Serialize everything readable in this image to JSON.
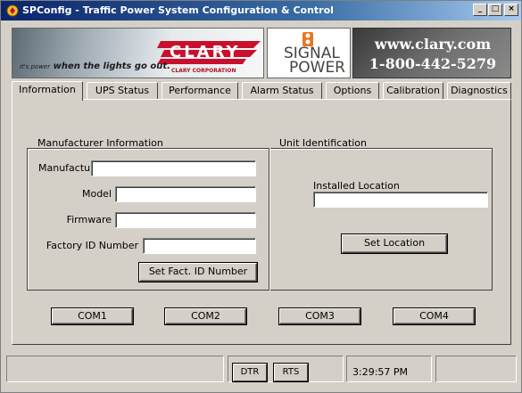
{
  "window": {
    "title": "SPConfig - Traffic Power System Configuration & Control",
    "controls": {
      "minimize": "_",
      "maximize": "□",
      "close": "×"
    }
  },
  "banner": {
    "tagline_prefix": "it's power",
    "tagline_main": "when the lights go out.",
    "brand": "CLARY",
    "brand_sub": "CLARY CORPORATION",
    "signal_line1": "SIGNAL",
    "signal_line2": "POWER",
    "website": "www.clary.com",
    "phone": "1-800-442-5279"
  },
  "tabs": [
    {
      "label": "Information",
      "active": true
    },
    {
      "label": "UPS Status",
      "active": false
    },
    {
      "label": "Performance",
      "active": false
    },
    {
      "label": "Alarm Status",
      "active": false
    },
    {
      "label": "Options",
      "active": false
    },
    {
      "label": "Calibration",
      "active": false
    },
    {
      "label": "Diagnostics",
      "active": false
    }
  ],
  "manufacturer_info": {
    "title": "Manufacturer Information",
    "manufacturer_label": "Manufacturer",
    "manufacturer_value": "",
    "model_label": "Model",
    "model_value": "",
    "firmware_label": "Firmware",
    "firmware_value": "",
    "factory_id_label": "Factory ID Number",
    "factory_id_value": "",
    "set_factory_id_button": "Set Fact. ID Number"
  },
  "unit_identification": {
    "title": "Unit Identification",
    "installed_location_label": "Installed Location",
    "installed_location_value": "",
    "set_location_button": "Set Location"
  },
  "com_ports": [
    "COM1",
    "COM2",
    "COM3",
    "COM4"
  ],
  "statusbar": {
    "dtr": "DTR",
    "rts": "RTS",
    "time": "3:29:57 PM"
  },
  "colors": {
    "title_bar": "#0a246a",
    "brand_red": "#c8102e",
    "signal_orange": "#e87722"
  }
}
